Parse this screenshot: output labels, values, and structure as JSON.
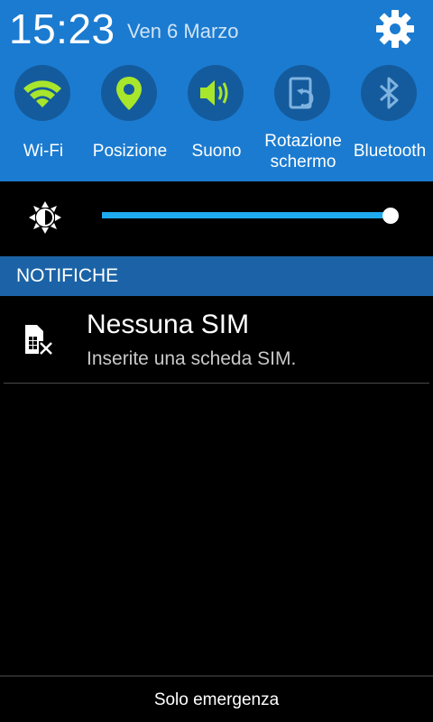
{
  "status": {
    "time": "15:23",
    "date": "Ven 6 Marzo",
    "settings_icon": "gear-icon"
  },
  "quick_settings": [
    {
      "name": "wifi",
      "label": "Wi-Fi",
      "icon": "wifi-icon",
      "active": true
    },
    {
      "name": "location",
      "label": "Posizione",
      "icon": "location-pin-icon",
      "active": true
    },
    {
      "name": "sound",
      "label": "Suono",
      "icon": "speaker-icon",
      "active": true
    },
    {
      "name": "rotation",
      "label_line1": "Rotazione",
      "label_line2": "schermo",
      "icon": "screen-rotation-icon",
      "active": false
    },
    {
      "name": "bluetooth",
      "label": "Bluetooth",
      "icon": "bluetooth-icon",
      "active": false
    }
  ],
  "brightness": {
    "icon": "brightness-icon",
    "level": 1.0
  },
  "notifications": {
    "header": "NOTIFICHE",
    "items": [
      {
        "icon": "sim-card-missing-icon",
        "title": "Nessuna SIM",
        "text": "Inserite una scheda SIM."
      }
    ]
  },
  "footer": {
    "carrier_text": "Solo emergenza"
  },
  "colors": {
    "header_bg": "#1b7bd0",
    "toggle_circle": "#145b9d",
    "active_icon": "#a8e62c",
    "inactive_icon": "#7fb3e0",
    "slider": "#1fa9f0",
    "notif_header_bg": "#1b63a6"
  }
}
